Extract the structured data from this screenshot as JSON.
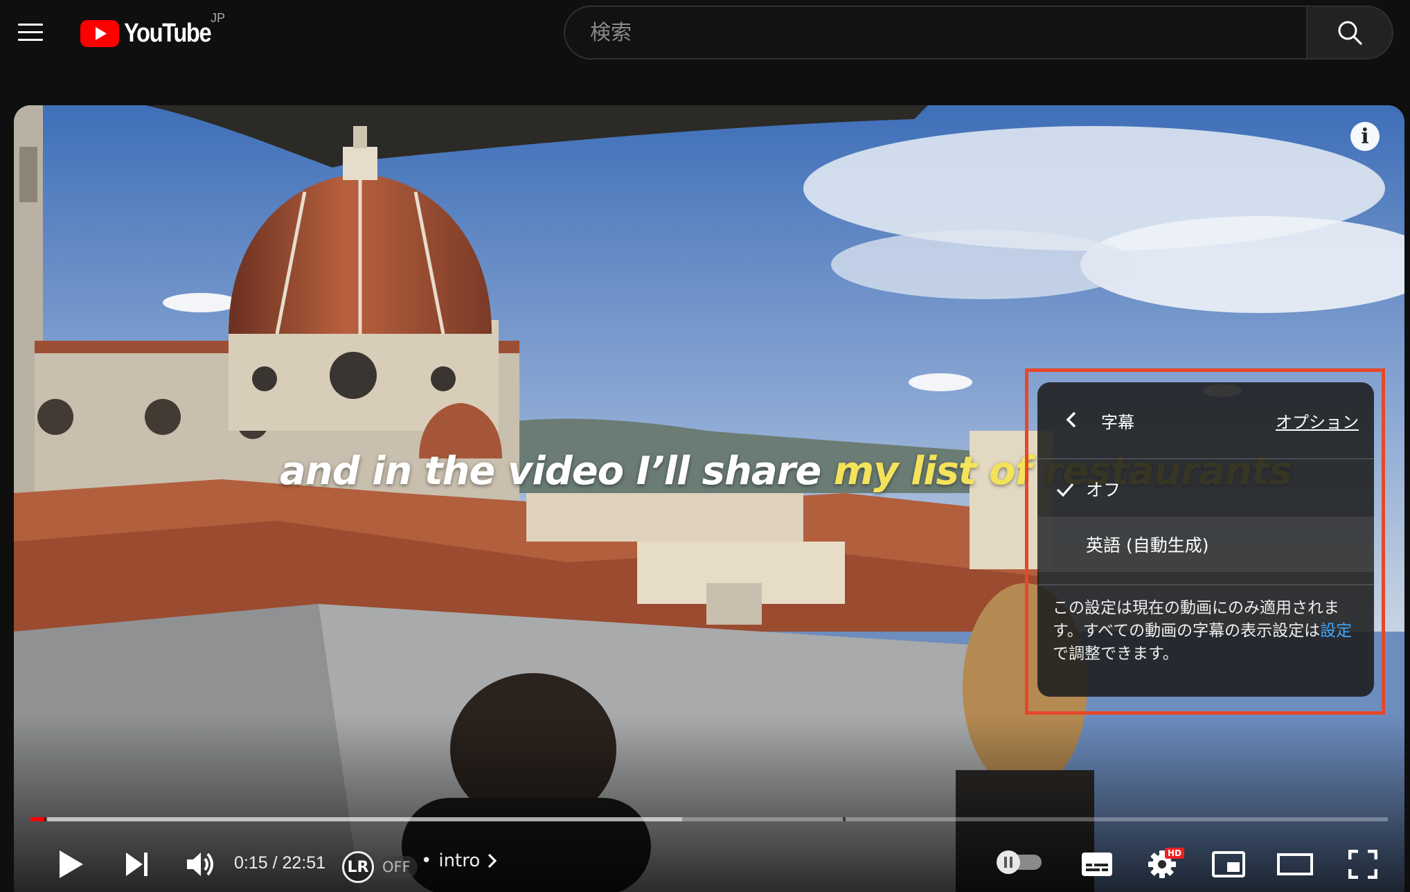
{
  "header": {
    "logo_text": "YouTube",
    "region": "JP",
    "search_placeholder": "検索"
  },
  "video": {
    "caption_white": "and in the video I’ll share",
    "caption_yellow": "my list of restaurants",
    "info_label": "i"
  },
  "player": {
    "current_time": "0:15",
    "time_separator": "/",
    "duration": "22:51",
    "progress_fraction": 0.011,
    "lr_badge": "LR",
    "lr_state": "OFF",
    "chapter_prefix": "•",
    "chapter": "intro",
    "hd_badge": "HD"
  },
  "subtitle_menu": {
    "title": "字幕",
    "options_link": "オプション",
    "items": [
      {
        "label": "オフ",
        "selected": true
      },
      {
        "label": "英語 (自動生成)",
        "selected": false
      }
    ],
    "note_part1": "この設定は現在の動画にのみ適用されます。すべての動画の字幕の表示設定は",
    "note_link": "設定",
    "note_part2": "で調整できます。"
  },
  "colors": {
    "brand_red": "#ff0000",
    "highlight_border": "#e4482a",
    "caption_yellow": "#f3e35a",
    "link_blue": "#3ea6ff"
  },
  "icons": [
    "menu-icon",
    "youtube-logo-icon",
    "search-icon",
    "info-icon",
    "play-icon",
    "next-icon",
    "volume-icon",
    "chevron-right-icon",
    "autoplay-toggle-icon",
    "subtitles-icon",
    "settings-gear-icon",
    "miniplayer-icon",
    "theater-mode-icon",
    "fullscreen-icon",
    "chevron-left-icon",
    "check-icon"
  ]
}
